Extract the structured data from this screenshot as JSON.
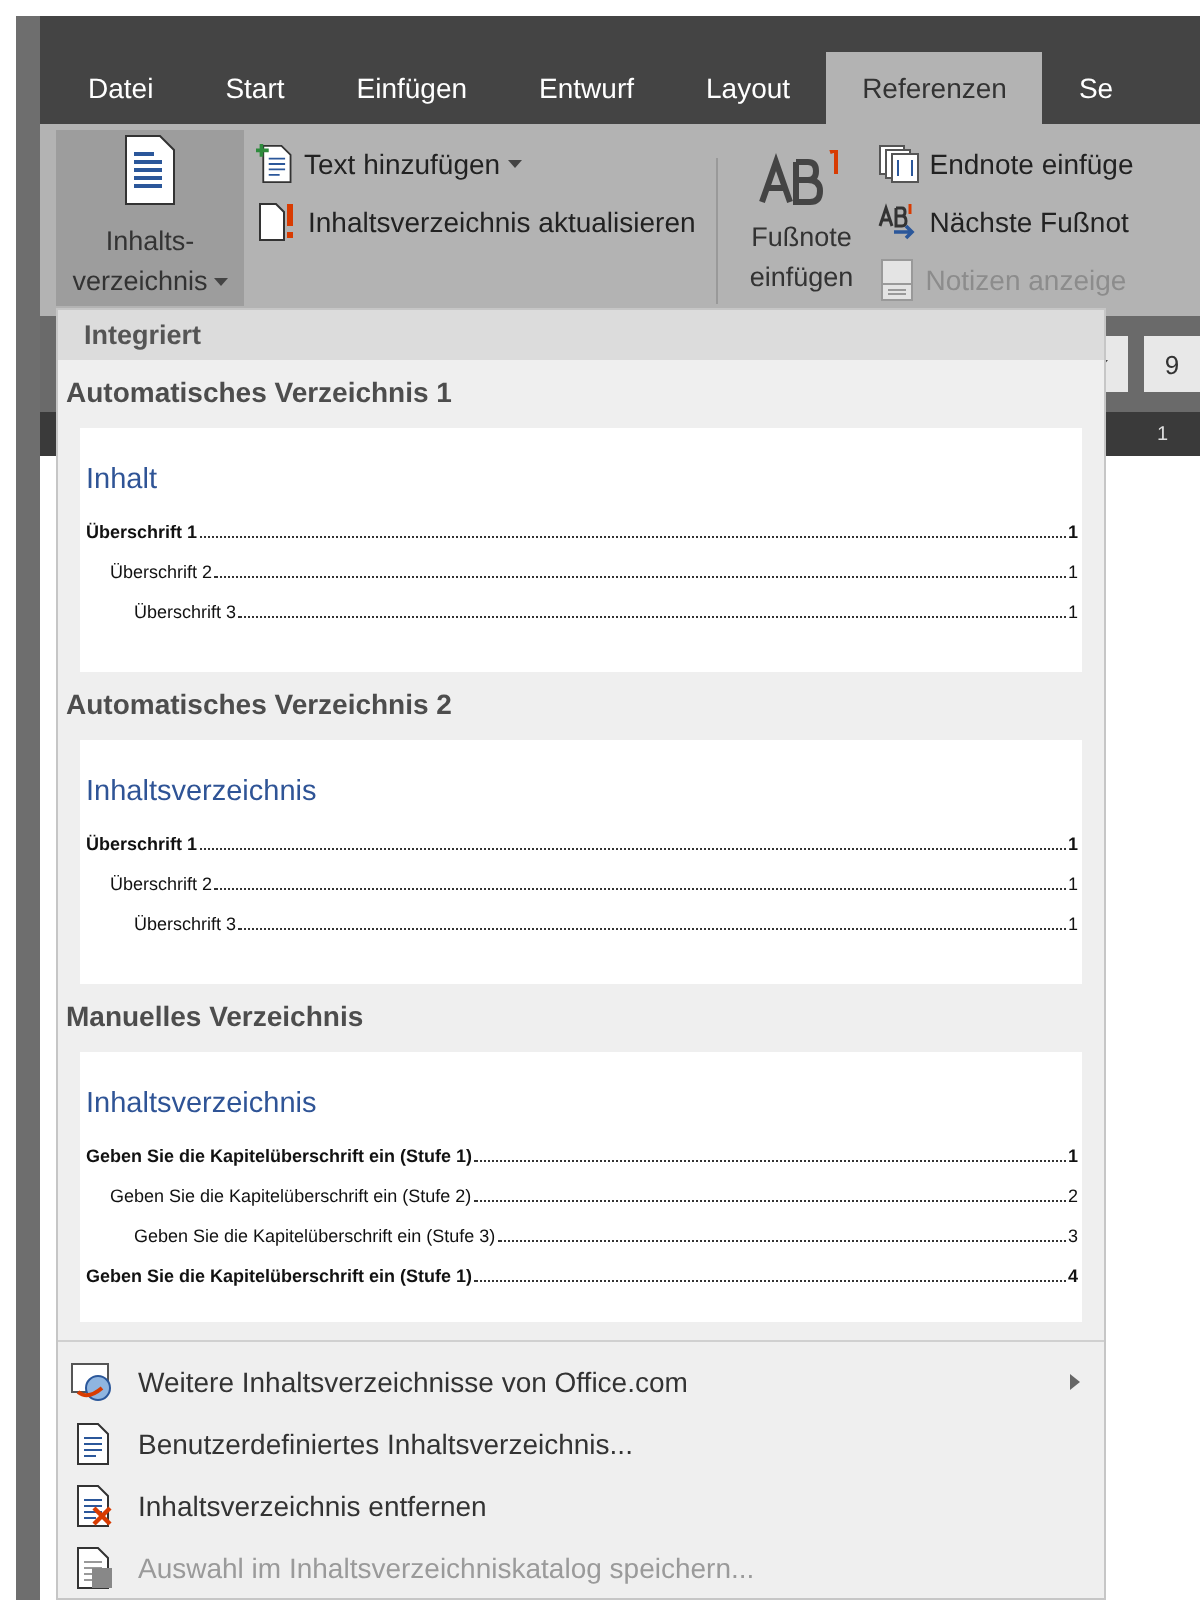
{
  "tabs": [
    {
      "label": "Datei",
      "selected": false
    },
    {
      "label": "Start",
      "selected": false
    },
    {
      "label": "Einfügen",
      "selected": false
    },
    {
      "label": "Entwurf",
      "selected": false
    },
    {
      "label": "Layout",
      "selected": false
    },
    {
      "label": "Referenzen",
      "selected": true
    },
    {
      "label": "Se",
      "selected": false
    }
  ],
  "ribbon": {
    "toc_button": {
      "lines": [
        "Inhalts-",
        "verzeichnis"
      ],
      "expanded": true
    },
    "toc_commands": [
      {
        "label": "Text hinzufügen",
        "kind": "add-text",
        "dropdown": true
      },
      {
        "label": "Inhaltsverzeichnis aktualisieren",
        "kind": "update",
        "dropdown": false
      }
    ],
    "footnote_button": {
      "lines": [
        "Fußnote",
        "einfügen"
      ]
    },
    "note_commands": [
      {
        "label": "Endnote einfüge",
        "kind": "endnote",
        "disabled": false
      },
      {
        "label": "Nächste Fußnot",
        "kind": "next",
        "disabled": false
      },
      {
        "label": "Notizen anzeige",
        "kind": "show",
        "disabled": true
      }
    ]
  },
  "document": {
    "font_size": "9",
    "ruler_mark": "1"
  },
  "menu": {
    "header": "Integriert",
    "gallery": [
      {
        "title": "Automatisches Verzeichnis 1",
        "heading": "Inhalt",
        "entries": [
          {
            "text": "Überschrift 1",
            "page": "1",
            "children": [
              {
                "text": "Überschrift 2",
                "page": "1",
                "children": [
                  {
                    "text": "Überschrift 3",
                    "page": "1"
                  }
                ]
              }
            ]
          }
        ]
      },
      {
        "title": "Automatisches Verzeichnis 2",
        "heading": "Inhaltsverzeichnis",
        "entries": [
          {
            "text": "Überschrift 1",
            "page": "1",
            "children": [
              {
                "text": "Überschrift 2",
                "page": "1",
                "children": [
                  {
                    "text": "Überschrift 3",
                    "page": "1"
                  }
                ]
              }
            ]
          }
        ]
      },
      {
        "title": "Manuelles Verzeichnis",
        "heading": "Inhaltsverzeichnis",
        "entries": [
          {
            "text": "Geben Sie die Kapitelüberschrift ein (Stufe 1)",
            "page": "1",
            "children": [
              {
                "text": "Geben Sie die Kapitelüberschrift ein (Stufe 2)",
                "page": "2",
                "children": [
                  {
                    "text": "Geben Sie die Kapitelüberschrift ein (Stufe 3)",
                    "page": "3"
                  }
                ]
              }
            ]
          },
          {
            "text": "Geben Sie die Kapitelüberschrift ein (Stufe 1)",
            "page": "4"
          }
        ]
      }
    ],
    "commands": [
      {
        "label": "Weitere Inhaltsverzeichnisse von Office.com",
        "kind": "web",
        "submenu": true,
        "disabled": false
      },
      {
        "label": "Benutzerdefiniertes Inhaltsverzeichnis...",
        "kind": "custom",
        "submenu": false,
        "disabled": false
      },
      {
        "label": "Inhaltsverzeichnis entfernen",
        "kind": "remove",
        "submenu": false,
        "disabled": false
      },
      {
        "label": "Auswahl im Inhaltsverzeichniskatalog speichern...",
        "kind": "save",
        "submenu": false,
        "disabled": true
      }
    ]
  }
}
